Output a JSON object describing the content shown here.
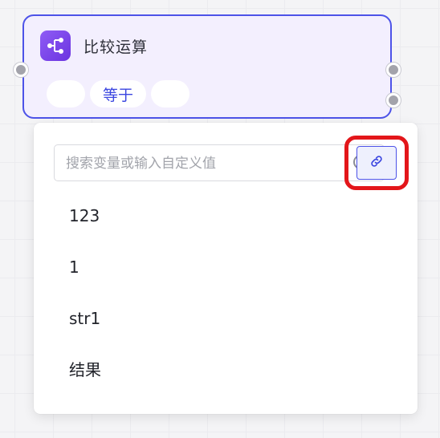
{
  "node": {
    "title": "比较运算",
    "icon": "branch-icon",
    "operator": "等于",
    "left_operand": "",
    "right_operand": ""
  },
  "dropdown": {
    "search_placeholder": "搜索变量或输入自定义值",
    "search_value": "",
    "search_icon": "search-icon",
    "link_icon": "link-icon",
    "options": [
      {
        "label": "123"
      },
      {
        "label": "1"
      },
      {
        "label": "str1"
      },
      {
        "label": "结果"
      }
    ]
  },
  "colors": {
    "accent": "#4d53e8",
    "node_bg": "#f3effe",
    "icon_gradient_start": "#8f5cf5",
    "icon_gradient_end": "#6b34e0",
    "highlight": "#e3161a"
  }
}
